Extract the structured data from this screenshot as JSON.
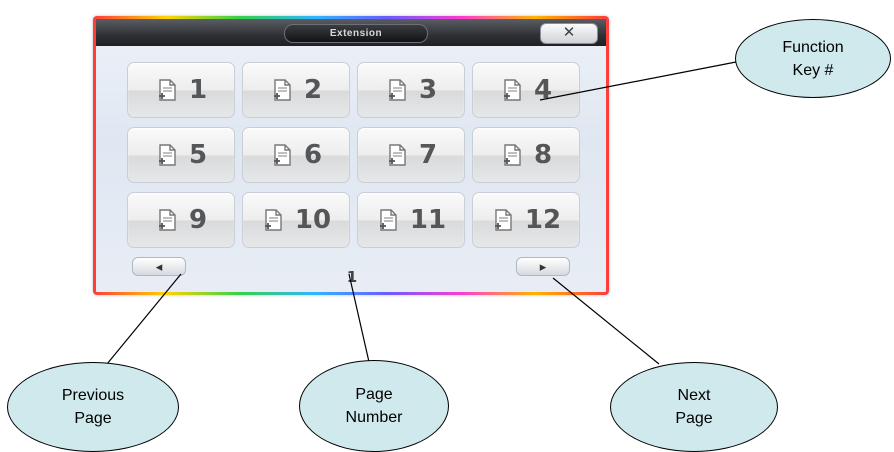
{
  "window": {
    "title": "Extension",
    "close_label": "✕"
  },
  "keys": [
    "1",
    "2",
    "3",
    "4",
    "5",
    "6",
    "7",
    "8",
    "9",
    "10",
    "11",
    "12"
  ],
  "pager": {
    "page_number": "1",
    "prev_glyph": "◂",
    "next_glyph": "▸"
  },
  "callouts": {
    "function_key": [
      "Function",
      "Key #"
    ],
    "previous_page": [
      "Previous",
      "Page"
    ],
    "page_number": [
      "Page",
      "Number"
    ],
    "next_page": [
      "Next",
      "Page"
    ]
  },
  "colors": {
    "bubble_fill": "#cfe9ec",
    "titlebar": "#2f3136"
  }
}
